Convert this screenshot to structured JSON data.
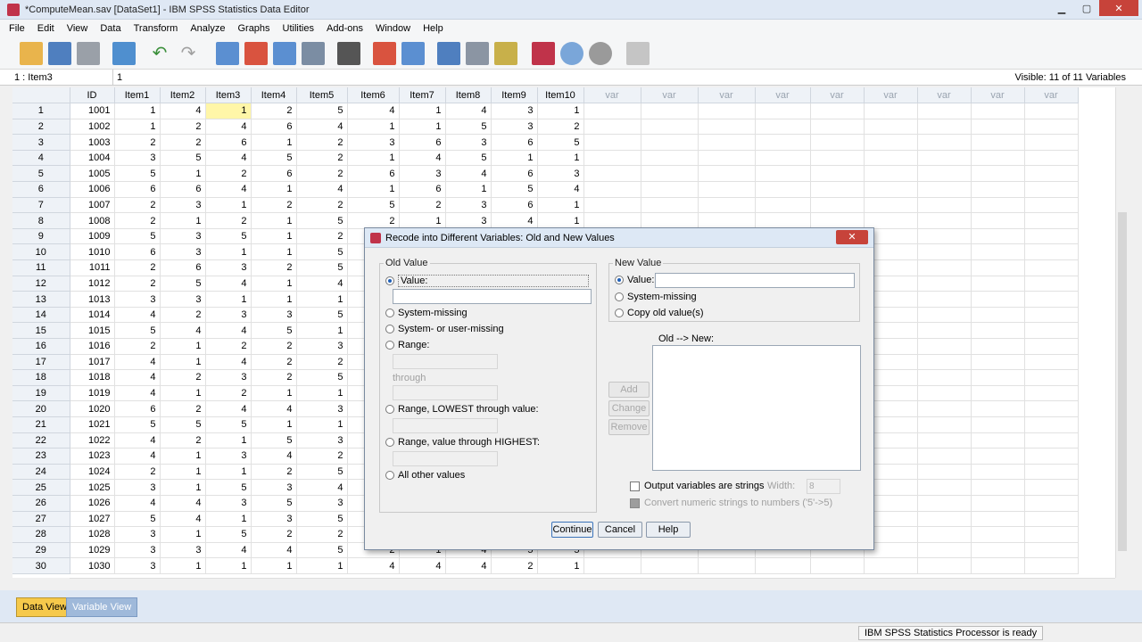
{
  "window": {
    "title": "*ComputeMean.sav [DataSet1] - IBM SPSS Statistics Data Editor"
  },
  "menu": [
    "File",
    "Edit",
    "View",
    "Data",
    "Transform",
    "Analyze",
    "Graphs",
    "Utilities",
    "Add-ons",
    "Window",
    "Help"
  ],
  "cellbar": {
    "ref": "1 : Item3",
    "value": "1",
    "visible": "Visible: 11 of 11 Variables"
  },
  "columns": [
    "ID",
    "Item1",
    "Item2",
    "Item3",
    "Item4",
    "Item5",
    "Item6",
    "Item7",
    "Item8",
    "Item9",
    "Item10",
    "var",
    "var",
    "var",
    "var",
    "var",
    "var",
    "var",
    "var",
    "var"
  ],
  "rows": [
    [
      1001,
      1,
      4,
      1,
      2,
      5,
      4,
      1,
      4,
      3,
      1
    ],
    [
      1002,
      1,
      2,
      4,
      6,
      4,
      1,
      1,
      5,
      3,
      2
    ],
    [
      1003,
      2,
      2,
      6,
      1,
      2,
      3,
      6,
      3,
      6,
      5
    ],
    [
      1004,
      3,
      5,
      4,
      5,
      2,
      1,
      4,
      5,
      1,
      1
    ],
    [
      1005,
      5,
      1,
      2,
      6,
      2,
      6,
      3,
      4,
      6,
      3
    ],
    [
      1006,
      6,
      6,
      4,
      1,
      4,
      1,
      6,
      1,
      5,
      4
    ],
    [
      1007,
      2,
      3,
      1,
      2,
      2,
      5,
      2,
      3,
      6,
      1
    ],
    [
      1008,
      2,
      1,
      2,
      1,
      5,
      2,
      1,
      3,
      4,
      1
    ],
    [
      1009,
      5,
      3,
      5,
      1,
      2,
      "",
      "",
      "",
      "",
      ""
    ],
    [
      1010,
      6,
      3,
      1,
      1,
      5,
      "",
      "",
      "",
      "",
      ""
    ],
    [
      1011,
      2,
      6,
      3,
      2,
      5,
      "",
      "",
      "",
      "",
      ""
    ],
    [
      1012,
      2,
      5,
      4,
      1,
      4,
      "",
      "",
      "",
      "",
      ""
    ],
    [
      1013,
      3,
      3,
      1,
      1,
      1,
      "",
      "",
      "",
      "",
      ""
    ],
    [
      1014,
      4,
      2,
      3,
      3,
      5,
      "",
      "",
      "",
      "",
      ""
    ],
    [
      1015,
      5,
      4,
      4,
      5,
      1,
      "",
      "",
      "",
      "",
      ""
    ],
    [
      1016,
      2,
      1,
      2,
      2,
      3,
      "",
      "",
      "",
      "",
      ""
    ],
    [
      1017,
      4,
      1,
      4,
      2,
      2,
      "",
      "",
      "",
      "",
      ""
    ],
    [
      1018,
      4,
      2,
      3,
      2,
      5,
      "",
      "",
      "",
      "",
      ""
    ],
    [
      1019,
      4,
      1,
      2,
      1,
      1,
      "",
      "",
      "",
      "",
      ""
    ],
    [
      1020,
      6,
      2,
      4,
      4,
      3,
      "",
      "",
      "",
      "",
      ""
    ],
    [
      1021,
      5,
      5,
      5,
      1,
      1,
      "",
      "",
      "",
      "",
      ""
    ],
    [
      1022,
      4,
      2,
      1,
      5,
      3,
      "",
      "",
      "",
      "",
      ""
    ],
    [
      1023,
      4,
      1,
      3,
      4,
      2,
      "",
      "",
      "",
      "",
      ""
    ],
    [
      1024,
      2,
      1,
      1,
      2,
      5,
      "",
      "",
      "",
      "",
      ""
    ],
    [
      1025,
      3,
      1,
      5,
      3,
      4,
      "",
      "",
      "",
      "",
      ""
    ],
    [
      1026,
      4,
      4,
      3,
      5,
      3,
      "",
      "",
      "",
      "",
      ""
    ],
    [
      1027,
      5,
      4,
      1,
      3,
      5,
      "",
      "",
      "",
      "",
      ""
    ],
    [
      1028,
      3,
      1,
      5,
      2,
      2,
      "",
      "",
      "",
      "",
      ""
    ],
    [
      1029,
      3,
      3,
      4,
      4,
      5,
      2,
      1,
      4,
      5,
      5
    ],
    [
      1030,
      3,
      1,
      1,
      1,
      1,
      4,
      4,
      4,
      2,
      1
    ]
  ],
  "tabs": {
    "data_view": "Data View",
    "variable_view": "Variable View"
  },
  "status": {
    "processor": "IBM SPSS Statistics Processor is ready"
  },
  "dialog": {
    "title": "Recode into Different Variables: Old and New Values",
    "close": "✕",
    "old_value": {
      "legend": "Old Value",
      "value": "Value:",
      "system_missing": "System-missing",
      "system_or_user_missing": "System- or user-missing",
      "range": "Range:",
      "through": "through",
      "range_lowest": "Range, LOWEST through value:",
      "range_highest": "Range, value through HIGHEST:",
      "all_other": "All other values"
    },
    "new_value": {
      "legend": "New Value",
      "value": "Value:",
      "system_missing": "System-missing",
      "copy_old": "Copy old value(s)"
    },
    "old_new_label": "Old --> New:",
    "buttons": {
      "add": "Add",
      "change": "Change",
      "remove": "Remove",
      "continue": "Continue",
      "cancel": "Cancel",
      "help": "Help"
    },
    "output_strings": "Output variables are strings",
    "width_label": "Width:",
    "width_value": "8",
    "convert_numeric": "Convert numeric strings to numbers ('5'->5)"
  }
}
